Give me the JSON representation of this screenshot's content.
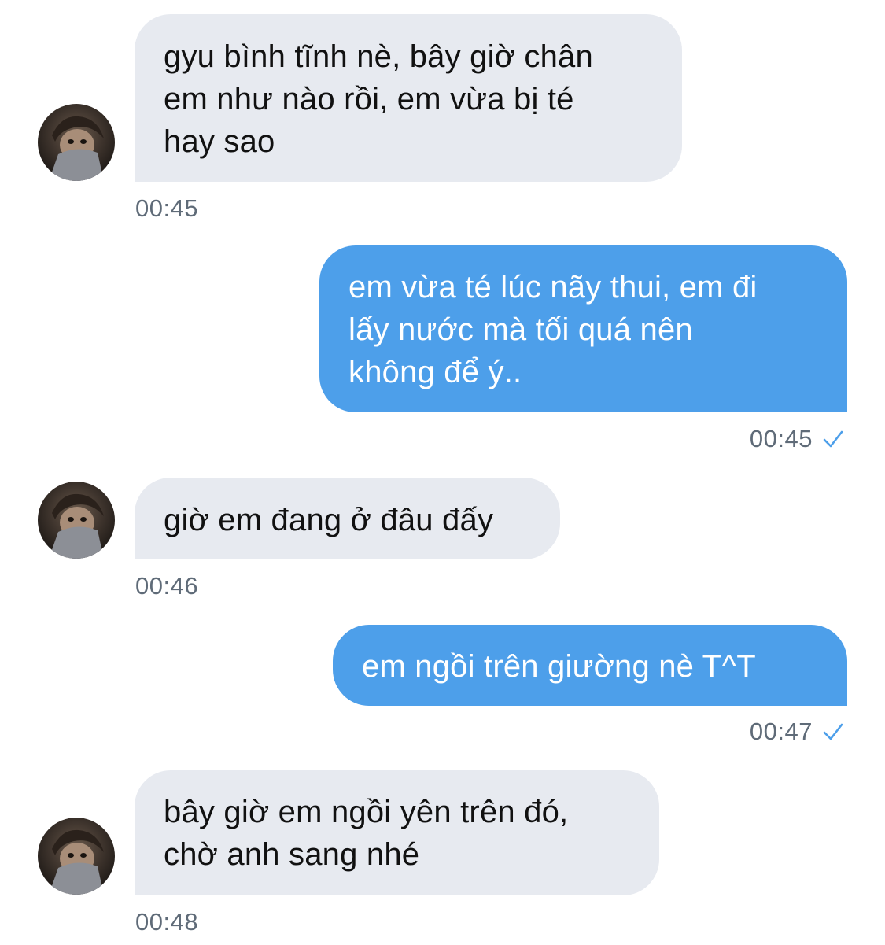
{
  "conversation": {
    "messages": [
      {
        "direction": "incoming",
        "text": "gyu bình tĩnh nè, bây giờ chân\nem như nào rồi, em vừa bị té\nhay sao",
        "time": "00:45"
      },
      {
        "direction": "outgoing",
        "text": "em vừa té lúc nãy thui, em đi\nlấy nước mà tối quá nên\nkhông để ý..",
        "time": "00:45",
        "status_icon": "checkmark-icon"
      },
      {
        "direction": "incoming",
        "text": "giờ em đang ở đâu đấy",
        "time": "00:46"
      },
      {
        "direction": "outgoing",
        "text": "em ngồi trên giường nè T^T",
        "time": "00:47",
        "status_icon": "checkmark-icon"
      },
      {
        "direction": "incoming",
        "text": "bây giờ em ngồi yên trên đó,\nchờ anh sang nhé",
        "time": "00:48"
      }
    ]
  },
  "colors": {
    "incoming_bubble": "#e7eaf0",
    "outgoing_bubble": "#4d9fea",
    "timestamp": "#5f6b78",
    "checkmark": "#4d9fea"
  }
}
